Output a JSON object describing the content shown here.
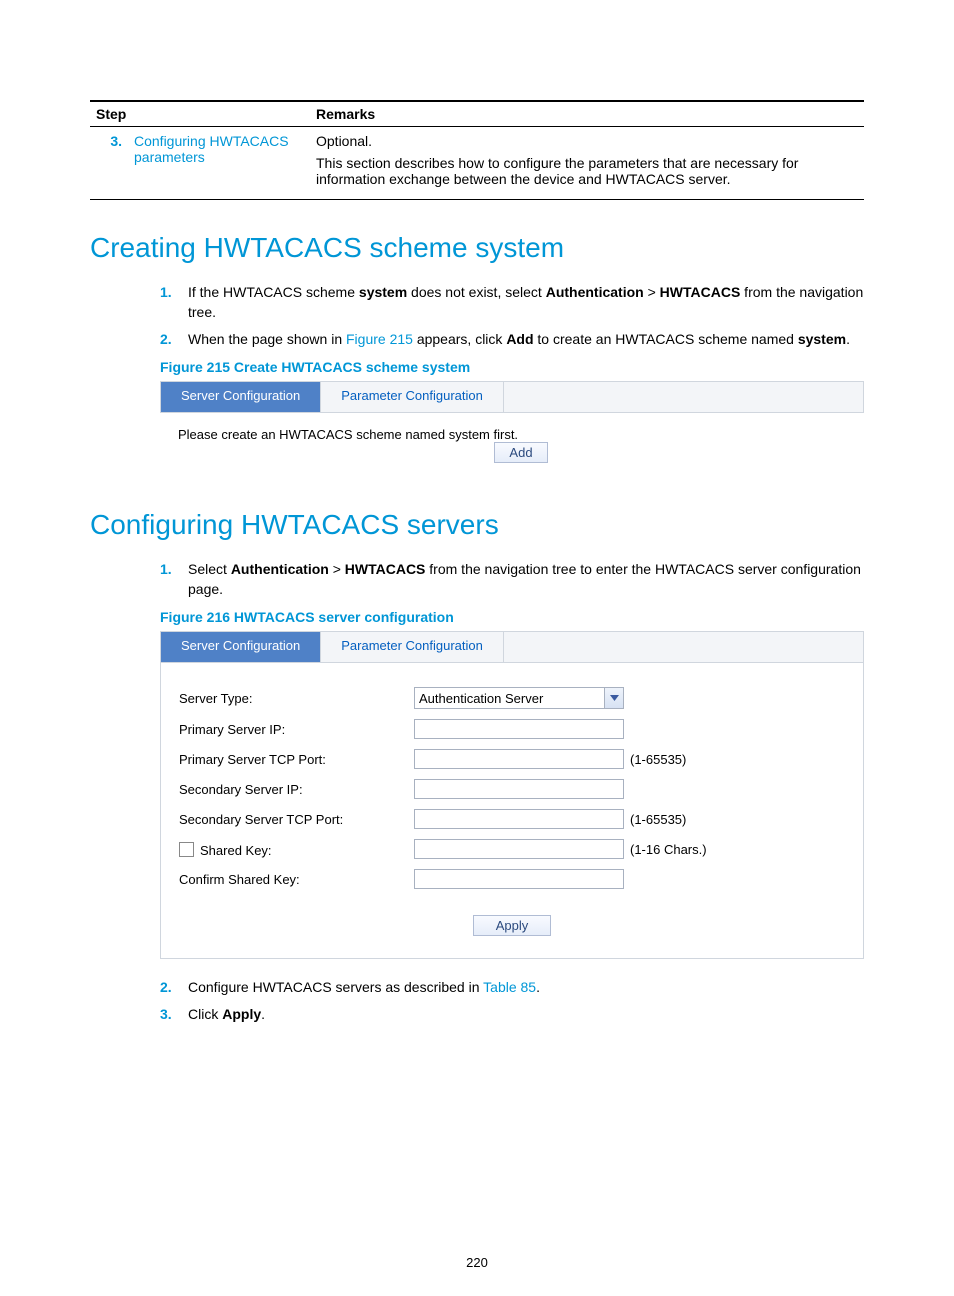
{
  "table": {
    "headers": {
      "step": "Step",
      "remarks": "Remarks"
    },
    "row": {
      "num": "3.",
      "link": "Configuring HWTACACS parameters",
      "remark1": "Optional.",
      "remark2": "This section describes how to configure the parameters that are necessary for information exchange between the device and HWTACACS server."
    }
  },
  "sec1": {
    "title": "Creating HWTACACS scheme system",
    "li1": {
      "num": "1.",
      "pre": "If the HWTACACS scheme ",
      "b1": "system",
      "mid": " does not exist, select ",
      "b2": "Authentication",
      "gt": " > ",
      "b3": "HWTACACS",
      "post": " from the navigation tree."
    },
    "li2": {
      "num": "2.",
      "pre": "When the page shown in ",
      "figlink": "Figure 215",
      "mid": " appears, click ",
      "b1": "Add",
      "mid2": " to create an HWTACACS scheme named ",
      "b2": "system",
      "post": "."
    },
    "figcap": "Figure 215 Create HWTACACS scheme system",
    "tab1": "Server Configuration",
    "tab2": "Parameter Configuration",
    "msg": "Please create an HWTACACS scheme named system first.",
    "addbtn": "Add"
  },
  "sec2": {
    "title": "Configuring HWTACACS servers",
    "li1": {
      "num": "1.",
      "pre": "Select ",
      "b1": "Authentication",
      "gt": " > ",
      "b2": "HWTACACS",
      "post": " from the navigation tree to enter the HWTACACS server configuration page."
    },
    "figcap": "Figure 216 HWTACACS server configuration",
    "tab1": "Server Configuration",
    "tab2": "Parameter Configuration",
    "fields": {
      "serverType": {
        "label": "Server Type:",
        "value": "Authentication Server"
      },
      "primaryIp": {
        "label": "Primary Server IP:"
      },
      "primaryPort": {
        "label": "Primary Server TCP Port:",
        "hint": "(1-65535)"
      },
      "secondaryIp": {
        "label": "Secondary Server IP:"
      },
      "secondaryPort": {
        "label": "Secondary Server TCP Port:",
        "hint": "(1-65535)"
      },
      "sharedKey": {
        "label": "Shared Key:",
        "hint": "(1-16 Chars.)"
      },
      "confirmKey": {
        "label": "Confirm Shared Key:"
      }
    },
    "applybtn": "Apply",
    "li2": {
      "num": "2.",
      "pre": "Configure HWTACACS servers as described in ",
      "tlink": "Table 85",
      "post": "."
    },
    "li3": {
      "num": "3.",
      "pre": "Click ",
      "b1": "Apply",
      "post": "."
    }
  },
  "pageNumber": "220"
}
